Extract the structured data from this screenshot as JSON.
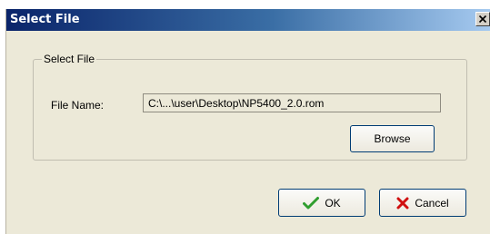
{
  "window": {
    "title": "Select File",
    "close_icon": "close-icon"
  },
  "group": {
    "legend": "Select File",
    "file_name_label": "File Name:",
    "file_name_value": "C:\\...\\user\\Desktop\\NP5400_2.0.rom",
    "browse_label": "Browse"
  },
  "footer": {
    "ok_label": "OK",
    "ok_icon": "checkmark-icon",
    "cancel_label": "Cancel",
    "cancel_icon": "red-x-icon"
  },
  "colors": {
    "titlebar_start": "#0a246a",
    "titlebar_end": "#a6caf0",
    "dialog_bg": "#ece9d8",
    "ok_icon": "#2f9e2f",
    "cancel_icon": "#d01010"
  }
}
